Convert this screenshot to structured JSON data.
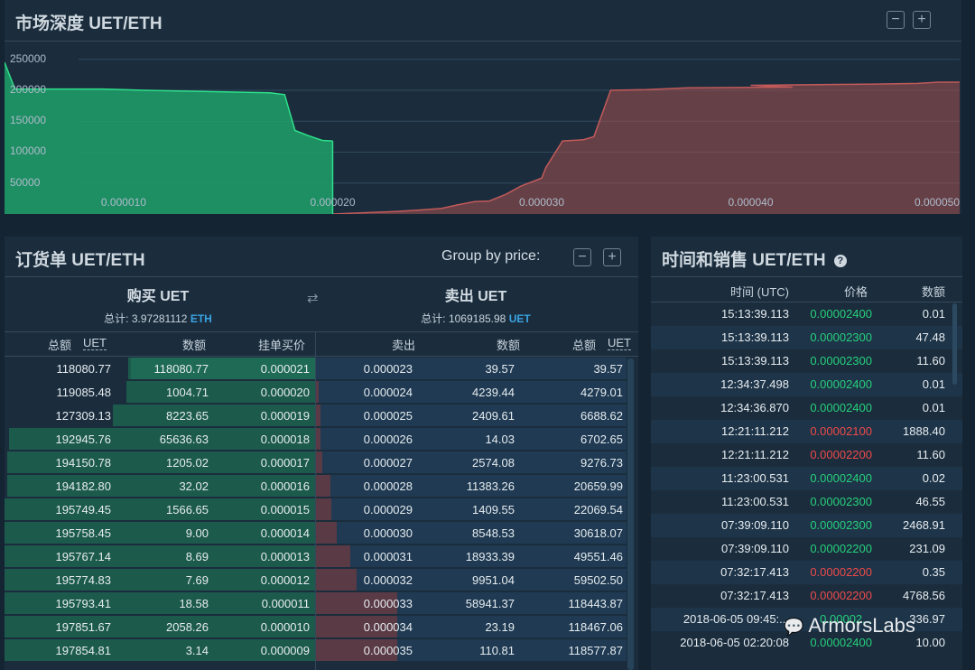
{
  "depth": {
    "title": "市场深度 UET/ETH",
    "y_ticks": [
      "250000",
      "200000",
      "150000",
      "100000",
      "50000"
    ],
    "x_ticks": [
      "0.000010",
      "0.000020",
      "0.000030",
      "0.000040",
      "0.000050"
    ],
    "colors": {
      "bid": "#1fa06a",
      "ask": "#a45050"
    }
  },
  "chart_data": {
    "type": "area",
    "title": "市场深度 UET/ETH",
    "xlabel": "",
    "ylabel": "",
    "xlim": [
      4.3e-06,
      5e-05
    ],
    "ylim": [
      0,
      270000
    ],
    "series": [
      {
        "name": "",
        "x": [
          4.3e-06,
          4.8e-06,
          9e-06,
          1.1e-05,
          1.4e-05,
          1.7e-05,
          1.77e-05,
          1.82e-05,
          1.88e-05,
          1.95e-05,
          2e-05
        ],
        "y": [
          245000,
          202000,
          202000,
          200000,
          198000,
          196000,
          193000,
          135000,
          127000,
          119000,
          118000
        ]
      },
      {
        "name": "",
        "x": [
          2e-05,
          2.15e-05,
          2.3e-05,
          2.4e-05,
          2.52e-05,
          2.6e-05,
          2.68e-05,
          2.75e-05,
          2.83e-05,
          2.9e-05,
          3e-05,
          3.02e-05,
          3.1e-05,
          3.2e-05,
          3.25e-05,
          3.33e-05,
          3.5e-05,
          3.7e-05,
          4.2e-05,
          4e-05,
          4.6e-05,
          4.8e-05,
          4.9e-05,
          5e-05
        ],
        "y": [
          0,
          2000,
          4000,
          6000,
          9000,
          15000,
          20000,
          21000,
          32000,
          45000,
          58000,
          75000,
          118000,
          120000,
          125000,
          200000,
          201000,
          204000,
          205000,
          208000,
          210000,
          211000,
          213000,
          213000
        ]
      }
    ]
  },
  "orderbook": {
    "title": "订货单 UET/ETH",
    "group_label": "Group by price:",
    "buy": {
      "title": "购买 UET",
      "total_label": "总计: 3.97281112",
      "total_unit": "ETH"
    },
    "sell": {
      "title": "卖出 UET",
      "total_label": "总计: 1069185.98",
      "total_unit": "UET"
    },
    "buy_headers": {
      "total": "总额",
      "unit": "UET",
      "amount": "数额",
      "price": "挂单买价"
    },
    "sell_headers": {
      "price": "卖出",
      "amount": "数额",
      "total": "总额",
      "unit": "UET"
    },
    "bids": [
      {
        "total": "118080.77",
        "amount": "118080.77",
        "price": "0.000021",
        "depth": 0.602,
        "amt": 0.592
      },
      {
        "total": "119085.48",
        "amount": "1004.71",
        "price": "0.000020",
        "depth": 0.608,
        "amt": 0.0
      },
      {
        "total": "127309.13",
        "amount": "8223.65",
        "price": "0.000019",
        "depth": 0.65,
        "amt": 0.0
      },
      {
        "total": "192945.76",
        "amount": "65636.63",
        "price": "0.000018",
        "depth": 0.985,
        "amt": 0.0
      },
      {
        "total": "194150.78",
        "amount": "1205.02",
        "price": "0.000017",
        "depth": 0.991,
        "amt": 0.0
      },
      {
        "total": "194182.80",
        "amount": "32.02",
        "price": "0.000016",
        "depth": 0.991,
        "amt": 0.0
      },
      {
        "total": "195749.45",
        "amount": "1566.65",
        "price": "0.000015",
        "depth": 0.999,
        "amt": 0.0
      },
      {
        "total": "195758.45",
        "amount": "9.00",
        "price": "0.000014",
        "depth": 0.999,
        "amt": 0.0
      },
      {
        "total": "195767.14",
        "amount": "8.69",
        "price": "0.000013",
        "depth": 0.999,
        "amt": 0.0
      },
      {
        "total": "195774.83",
        "amount": "7.69",
        "price": "0.000012",
        "depth": 0.999,
        "amt": 0.0
      },
      {
        "total": "195793.41",
        "amount": "18.58",
        "price": "0.000011",
        "depth": 0.999,
        "amt": 0.0
      },
      {
        "total": "197851.67",
        "amount": "2058.26",
        "price": "0.000010",
        "depth": 1.0,
        "amt": 0.0
      },
      {
        "total": "197854.81",
        "amount": "3.14",
        "price": "0.000009",
        "depth": 1.0,
        "amt": 0.0
      }
    ],
    "asks": [
      {
        "price": "0.000023",
        "amount": "39.57",
        "total": "39.57",
        "depth": 0.0
      },
      {
        "price": "0.000024",
        "amount": "4239.44",
        "total": "4279.01",
        "depth": 0.01
      },
      {
        "price": "0.000025",
        "amount": "2409.61",
        "total": "6688.62",
        "depth": 0.015
      },
      {
        "price": "0.000026",
        "amount": "14.03",
        "total": "6702.65",
        "depth": 0.015
      },
      {
        "price": "0.000027",
        "amount": "2574.08",
        "total": "9276.73",
        "depth": 0.021
      },
      {
        "price": "0.000028",
        "amount": "11383.26",
        "total": "20659.99",
        "depth": 0.046
      },
      {
        "price": "0.000029",
        "amount": "1409.55",
        "total": "22069.54",
        "depth": 0.049
      },
      {
        "price": "0.000030",
        "amount": "8548.53",
        "total": "30618.07",
        "depth": 0.068
      },
      {
        "price": "0.000031",
        "amount": "18933.39",
        "total": "49551.46",
        "depth": 0.11
      },
      {
        "price": "0.000032",
        "amount": "9951.04",
        "total": "59502.50",
        "depth": 0.132
      },
      {
        "price": "0.000033",
        "amount": "58941.37",
        "total": "118443.87",
        "depth": 0.263
      },
      {
        "price": "0.000034",
        "amount": "23.19",
        "total": "118467.06",
        "depth": 0.263
      },
      {
        "price": "0.000035",
        "amount": "110.81",
        "total": "118577.87",
        "depth": 0.263
      }
    ]
  },
  "trades": {
    "title": "时间和销售 UET/ETH",
    "headers": {
      "time": "时间 (UTC)",
      "price": "价格",
      "amount": "数额"
    },
    "rows": [
      {
        "time": "15:13:39.113",
        "price": "0.00002400",
        "amount": "0.01",
        "side": "buy"
      },
      {
        "time": "15:13:39.113",
        "price": "0.00002300",
        "amount": "47.48",
        "side": "buy"
      },
      {
        "time": "15:13:39.113",
        "price": "0.00002300",
        "amount": "11.60",
        "side": "buy"
      },
      {
        "time": "12:34:37.498",
        "price": "0.00002400",
        "amount": "0.01",
        "side": "buy"
      },
      {
        "time": "12:34:36.870",
        "price": "0.00002400",
        "amount": "0.01",
        "side": "buy"
      },
      {
        "time": "12:21:11.212",
        "price": "0.00002100",
        "amount": "1888.40",
        "side": "sell"
      },
      {
        "time": "12:21:11.212",
        "price": "0.00002200",
        "amount": "11.60",
        "side": "sell"
      },
      {
        "time": "11:23:00.531",
        "price": "0.00002400",
        "amount": "0.02",
        "side": "buy"
      },
      {
        "time": "11:23:00.531",
        "price": "0.00002300",
        "amount": "46.55",
        "side": "buy"
      },
      {
        "time": "07:39:09.110",
        "price": "0.00002300",
        "amount": "2468.91",
        "side": "buy"
      },
      {
        "time": "07:39:09.110",
        "price": "0.00002200",
        "amount": "231.09",
        "side": "buy"
      },
      {
        "time": "07:32:17.413",
        "price": "0.00002200",
        "amount": "0.35",
        "side": "sell"
      },
      {
        "time": "07:32:17.413",
        "price": "0.00002200",
        "amount": "4768.56",
        "side": "sell"
      },
      {
        "time": "2018-06-05 09:45:...",
        "price": "0.00002...",
        "amount": "336.97",
        "side": "buy"
      },
      {
        "time": "2018-06-05 02:20:08",
        "price": "0.00002400",
        "amount": "10.00",
        "side": "buy"
      }
    ],
    "colors": {
      "buy": "#26d07c",
      "sell": "#ef4a4a"
    }
  },
  "watermark": "ArmorsLabs"
}
